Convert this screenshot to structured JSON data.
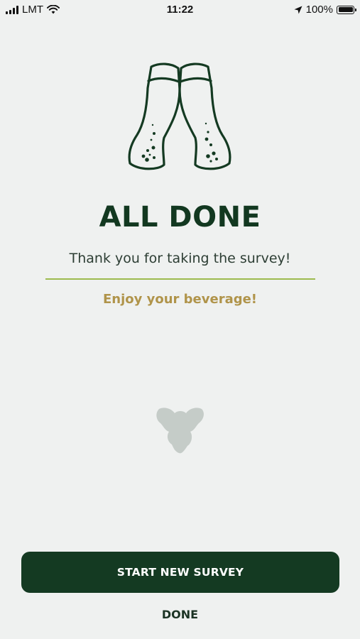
{
  "status_bar": {
    "carrier": "LMT",
    "time": "11:22",
    "battery": "100%",
    "icons": [
      "signal-icon",
      "wifi-icon",
      "location-arrow-icon",
      "battery-icon"
    ]
  },
  "hero": {
    "icon": "beer-glasses-cheers-icon"
  },
  "main": {
    "title": "ALL DONE",
    "subtitle": "Thank you for taking the survey!",
    "message": "Enjoy your beverage!",
    "brand_icon": "brand-logo-icon"
  },
  "actions": {
    "start_label": "START NEW SURVEY",
    "done_label": "DONE"
  },
  "colors": {
    "background": "#eff1f0",
    "primary": "#143a22",
    "title": "#123820",
    "divider": "#9dbb4f",
    "accent_gold": "#b0944a",
    "brand_mark": "#c5ccc8"
  }
}
